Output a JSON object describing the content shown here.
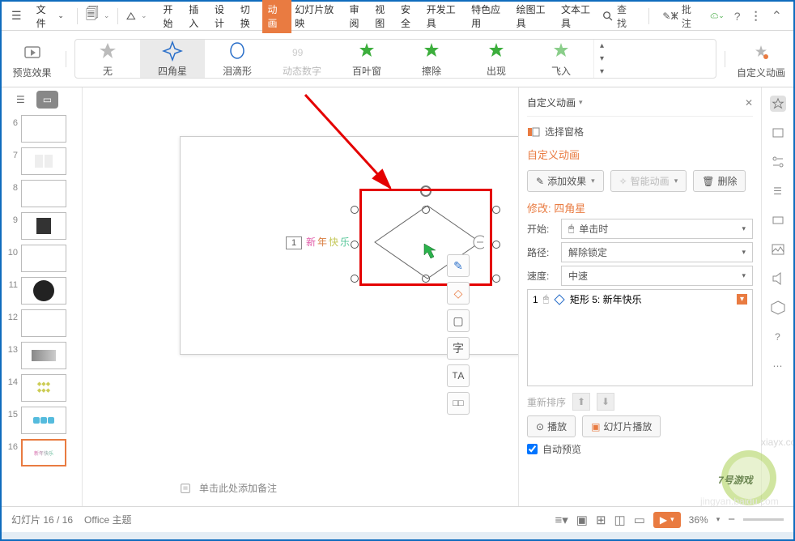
{
  "menu": {
    "file": "文件"
  },
  "tabs": [
    "开始",
    "插入",
    "设计",
    "切换",
    "动画",
    "幻灯片放映",
    "审阅",
    "视图",
    "安全",
    "开发工具",
    "特色应用",
    "绘图工具",
    "文本工具"
  ],
  "active_tab_index": 4,
  "search": "查找",
  "annotate": "批注",
  "ribbon": {
    "preview": "预览效果",
    "anims": [
      {
        "name": "无"
      },
      {
        "name": "四角星"
      },
      {
        "name": "泪滴形"
      },
      {
        "name": "动态数字",
        "dim": true
      },
      {
        "name": "百叶窗"
      },
      {
        "name": "擦除"
      },
      {
        "name": "出现"
      },
      {
        "name": "飞入"
      }
    ],
    "custom": "自定义动画"
  },
  "slides": {
    "numbers": [
      "6",
      "7",
      "8",
      "9",
      "10",
      "11",
      "12",
      "13",
      "14",
      "15",
      "16"
    ],
    "active_index": 10
  },
  "canvas": {
    "text": "新年快乐",
    "order": "1"
  },
  "notes_prompt": "单击此处添加备注",
  "panel": {
    "title": "自定义动画",
    "select_pane": "选择窗格",
    "heading": "自定义动画",
    "add_effect": "添加效果",
    "smart_anim": "智能动画",
    "delete": "删除",
    "modify_label": "修改: 四角星",
    "start_lbl": "开始:",
    "start_val": "单击时",
    "path_lbl": "路径:",
    "path_val": "解除锁定",
    "speed_lbl": "速度:",
    "speed_val": "中速",
    "list_item": {
      "idx": "1",
      "name": "矩形 5: 新年快乐"
    },
    "reorder": "重新排序",
    "play": "播放",
    "slideshow_play": "幻灯片播放",
    "auto_preview": "自动预览"
  },
  "statusbar": {
    "slide_info": "幻灯片 16 / 16",
    "theme": "Office 主题",
    "zoom": "36%"
  }
}
